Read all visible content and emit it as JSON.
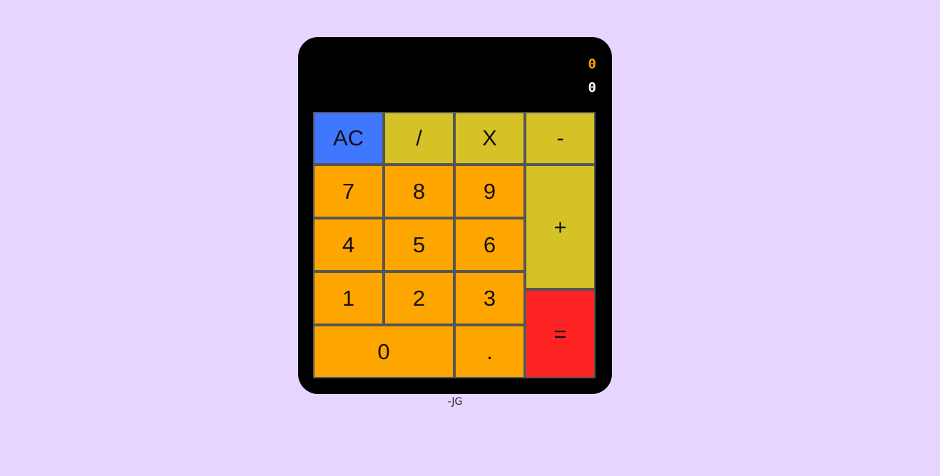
{
  "display": {
    "previous": "0",
    "current": "0"
  },
  "keys": {
    "clear": "AC",
    "divide": "/",
    "multiply": "X",
    "minus": "-",
    "plus": "+",
    "equals": "=",
    "dot": ".",
    "n7": "7",
    "n8": "8",
    "n9": "9",
    "n4": "4",
    "n5": "5",
    "n6": "6",
    "n1": "1",
    "n2": "2",
    "n3": "3",
    "n0": "0"
  },
  "footer": {
    "signature": "-JG"
  },
  "colors": {
    "page_background": "#e6d5ff",
    "calculator_body": "#000000",
    "clear_key": "#3f78ff",
    "operator_key": "#d4c226",
    "number_key": "#ffa500",
    "equals_key": "#ff2424",
    "previous_value_text": "#ffa500",
    "current_value_text": "#ffffff"
  }
}
